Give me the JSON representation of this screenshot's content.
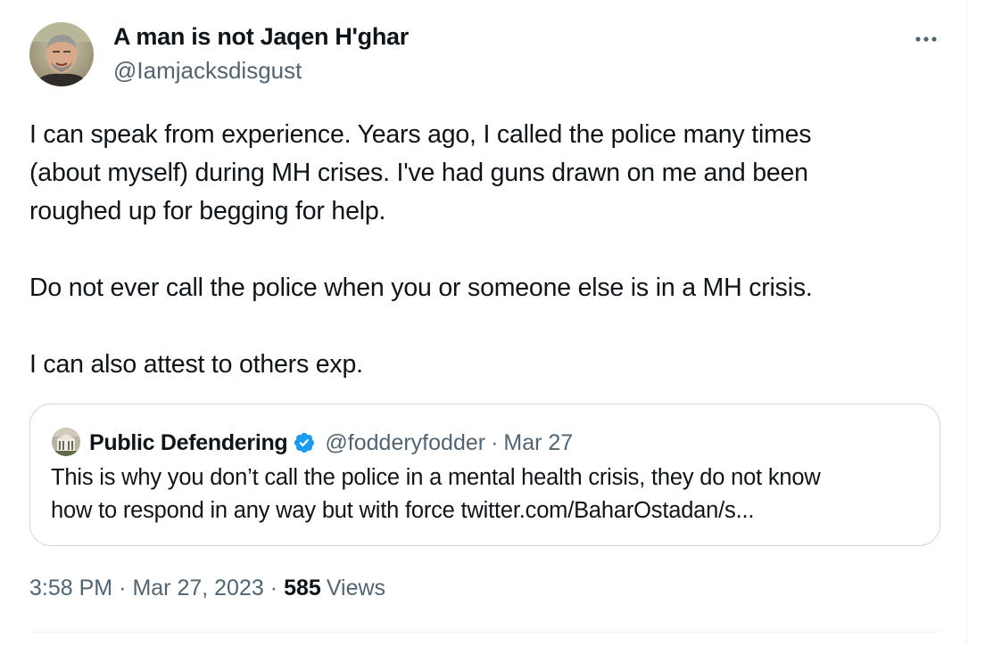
{
  "author": {
    "name": "A man is not Jaqen H'ghar",
    "handle": "@Iamjacksdisgust"
  },
  "more_icon": "more-horizontal-icon",
  "tweet": {
    "lines": [
      "I can speak from experience. Years ago, I called the police many times",
      "(about myself)  during MH crises. I've had guns drawn on me and been",
      "roughed up for begging for help.",
      "Do not ever call the police when you or someone else is in a MH crisis.",
      "I can also attest to others exp."
    ]
  },
  "quote": {
    "name": "Public Defendering",
    "verified_icon": "verified-badge-icon",
    "handle": "@fodderyfodder",
    "separator": "·",
    "date": "Mar 27",
    "text_lines": [
      "This is why you don’t call the police in a mental health crisis, they do not know",
      "how to respond in any way but with force twitter.com/BaharOstadan/s..."
    ]
  },
  "meta": {
    "time": "3:58 PM",
    "separator": "·",
    "date": "Mar 27, 2023",
    "views_count": "585",
    "views_label": "Views"
  },
  "colors": {
    "text": "#0f1419",
    "secondary": "#536471",
    "border": "#cfd9de",
    "verified": "#1d9bf0"
  }
}
